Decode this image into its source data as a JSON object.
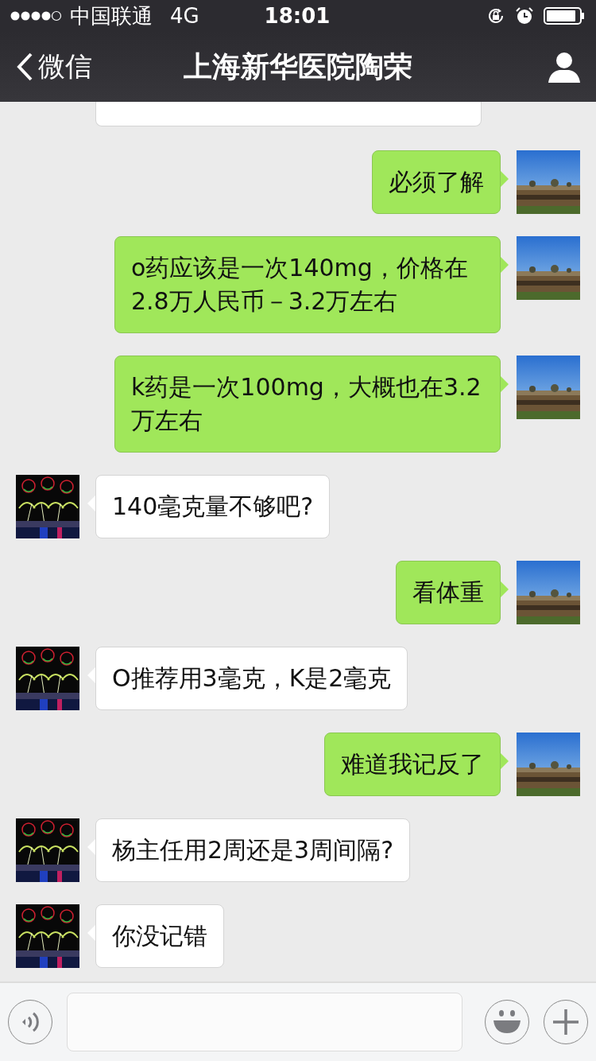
{
  "status_bar": {
    "carrier": "中国联通",
    "network": "4G",
    "time": "18:01"
  },
  "nav_bar": {
    "back_label": "微信",
    "title": "上海新华医院陶荣"
  },
  "chat": {
    "clipped_bubble": true,
    "messages": [
      {
        "kind": "sent",
        "text": "必须了解"
      },
      {
        "kind": "sent",
        "text": "o药应该是一次140mg，价格在2.8万人民币－3.2万左右"
      },
      {
        "kind": "sent",
        "text": "k药是一次100mg，大概也在3.2万左右"
      },
      {
        "kind": "received",
        "text": "140毫克量不够吧?"
      },
      {
        "kind": "sent",
        "text": "看体重"
      },
      {
        "kind": "received",
        "text": "O推荐用3毫克，K是2毫克"
      },
      {
        "kind": "sent",
        "text": "难道我记反了"
      },
      {
        "kind": "received",
        "text": "杨主任用2周还是3周间隔?"
      },
      {
        "kind": "received",
        "text": "你没记错"
      }
    ]
  }
}
